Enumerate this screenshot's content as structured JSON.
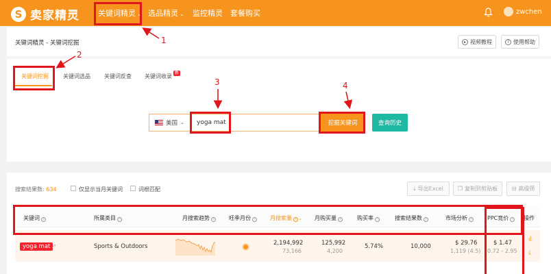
{
  "brand": {
    "name": "卖家精灵",
    "color_primary": "#f7941d",
    "color_teal": "#1fb8a3",
    "annotation_color": "#e0161c"
  },
  "nav": {
    "items": [
      {
        "label": "关键词精灵",
        "chevron": "⌄"
      },
      {
        "label": "选品精灵",
        "chevron": "⌄"
      },
      {
        "label": "监控精灵"
      },
      {
        "label": "套餐购买"
      }
    ],
    "bell_icon": "bell-icon",
    "user": "zwchen"
  },
  "breadcrumb": "关键词精灵 - 关键词挖掘",
  "header_buttons": {
    "video": "视频教程",
    "help": "使用帮助"
  },
  "tabs": [
    {
      "label": "关键词挖掘",
      "active": true
    },
    {
      "label": "关键词选品"
    },
    {
      "label": "关键词反查"
    },
    {
      "label": "关键词收录",
      "badge": "新"
    }
  ],
  "search": {
    "country": "美国",
    "keyword_value": "yoga mat",
    "dig_button": "挖掘关键词",
    "history_button": "查询历史"
  },
  "results": {
    "count_label": "搜索结果数:",
    "count": "634",
    "checkbox_monthly": "仅显示当月关键词",
    "checkbox_root": "词根匹配",
    "export": "导出Excel",
    "copy": "复制到剪贴板",
    "advanced": "高级筛"
  },
  "table": {
    "headers": [
      "关键词",
      "所属类目",
      "月搜索趋势",
      "旺季月份",
      "月搜索量",
      "月购买量",
      "购买率",
      "搜索结果数",
      "市场分析",
      "PPC竞价",
      "操作"
    ],
    "rows": [
      {
        "keyword": "yoga mat",
        "category": "Sports & Outdoors",
        "search_volume": "2,194,992",
        "search_volume_sub": "73,166",
        "purchases": "125,992",
        "purchases_sub": "4,200",
        "purchase_rate": "5.74%",
        "results": "10,000",
        "market_price": "$ 29.76",
        "market_sub": "1,119 (4.5)",
        "ppc": "$ 1.47",
        "ppc_range": "0.72 - 2.95"
      }
    ]
  },
  "annotations": [
    "1",
    "2",
    "3",
    "4"
  ]
}
